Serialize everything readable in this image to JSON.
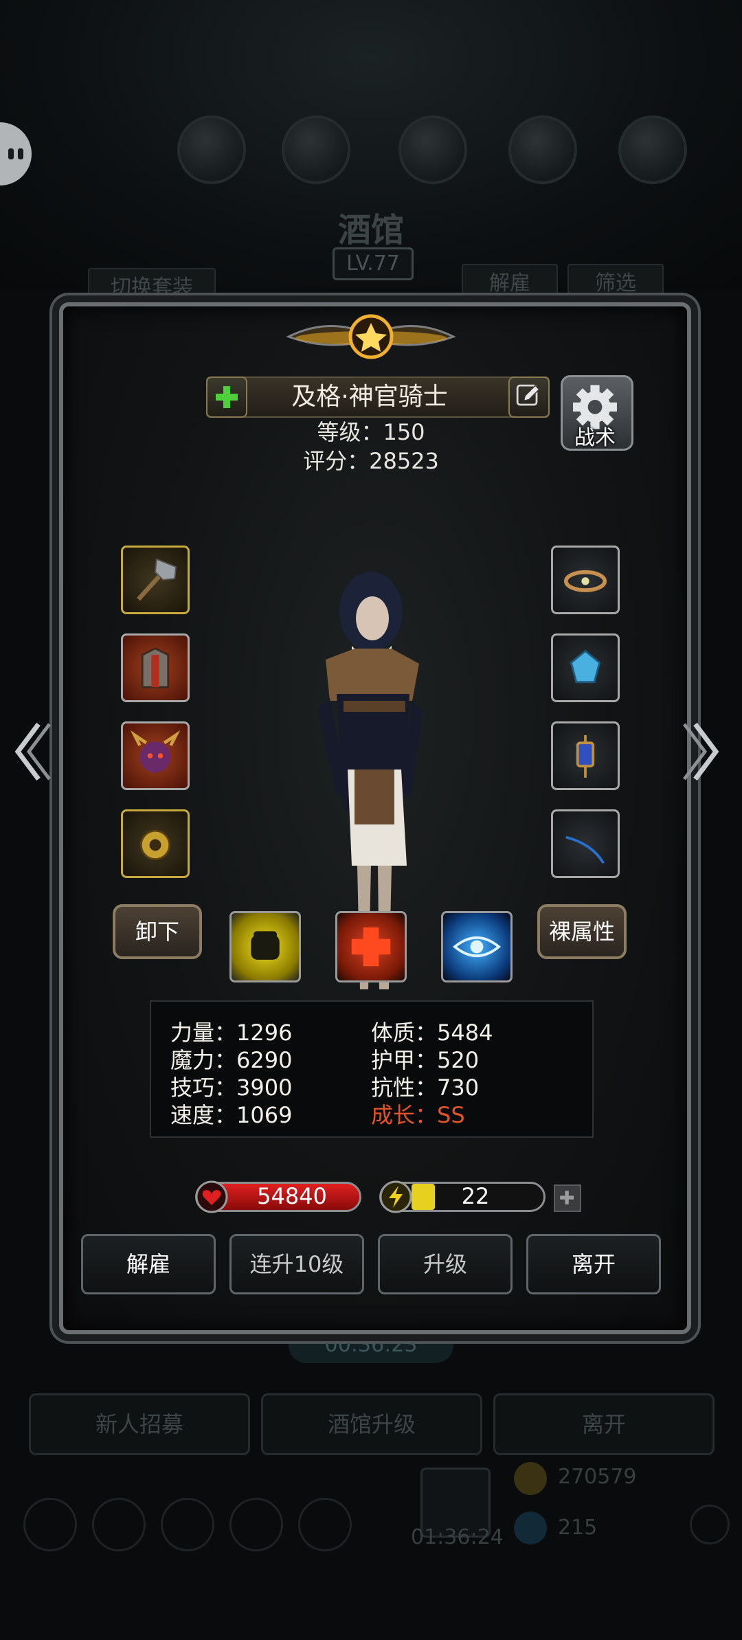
{
  "tavern": {
    "title": "酒馆",
    "level": "LV.77",
    "switch_outfit": "切换套装",
    "dismiss_tab": "解雇",
    "filter_tab": "筛选"
  },
  "hero": {
    "name": "及格·神官骑士",
    "level_label": "等级：150",
    "score_label": "评分：28523",
    "tactic_label": "战术"
  },
  "buttons": {
    "unequip": "卸下",
    "naked_stats": "裸属性"
  },
  "stats": {
    "left": [
      "力量：1296",
      "魔力：6290",
      "技巧：3900",
      "速度：1069"
    ],
    "right": [
      "体质：5484",
      "护甲：520",
      "抗性：730"
    ],
    "growth": "成长：SS"
  },
  "hp": "54840",
  "energy": "22",
  "energy_fill": 0.18,
  "actions": {
    "dismiss": "解雇",
    "level10": "连升10级",
    "upgrade": "升级",
    "leave": "离开"
  },
  "background": {
    "timer": "00:36:23",
    "recruit": "新人招募",
    "tavern_upgrade": "酒馆升级",
    "leave": "离开",
    "gold": "270579",
    "gems": "215",
    "timer2": "01:36:24"
  },
  "colors": {
    "growth": "#e0542a",
    "hp": "#d61a1a",
    "energy": "#e8d020"
  }
}
